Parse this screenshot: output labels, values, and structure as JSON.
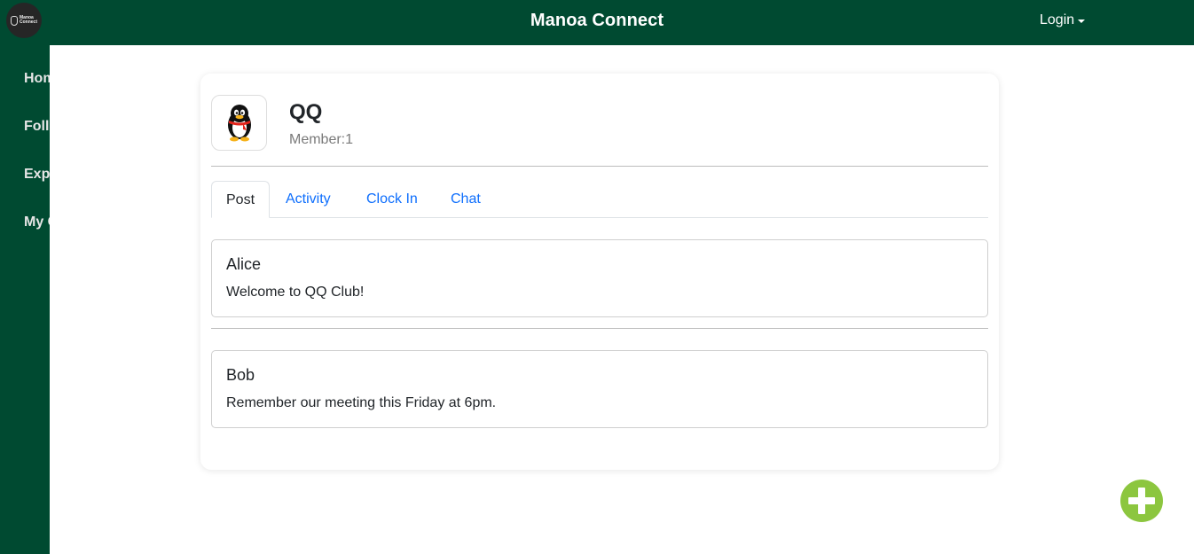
{
  "header": {
    "logo_line1": "Manoa",
    "logo_line2": "Connect",
    "title": "Manoa Connect",
    "login_label": "Login"
  },
  "sidebar": {
    "items": [
      {
        "label": "Home"
      },
      {
        "label": "Following"
      },
      {
        "label": "Explore"
      },
      {
        "label": "My Clubs"
      }
    ]
  },
  "club": {
    "icon": "penguin-icon",
    "name": "QQ",
    "members": "Member:1"
  },
  "tabs": [
    {
      "label": "Post",
      "active": true
    },
    {
      "label": "Activity",
      "active": false
    },
    {
      "label": "Clock In",
      "active": false
    },
    {
      "label": "Chat",
      "active": false
    }
  ],
  "posts": [
    {
      "author": "Alice",
      "text": "Welcome to QQ Club!"
    },
    {
      "author": "Bob",
      "text": "Remember our meeting this Friday at 6pm."
    }
  ],
  "fab": {
    "icon": "plus-icon"
  },
  "colors": {
    "brand": "#004a31",
    "link": "#0d6efd",
    "fab": "#8cc63f"
  }
}
